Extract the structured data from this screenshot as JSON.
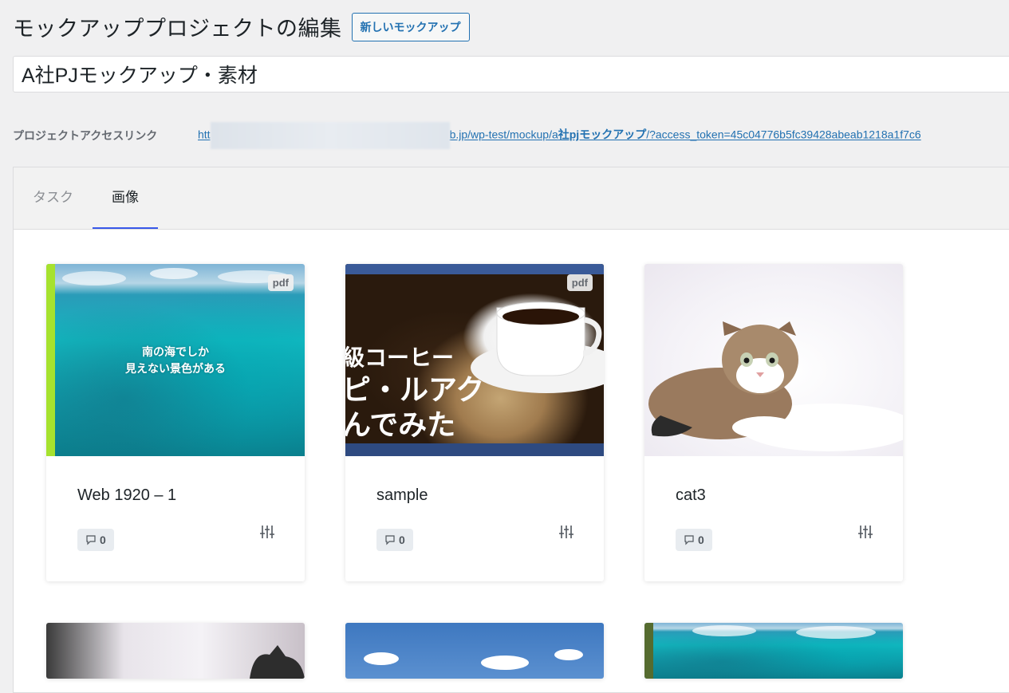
{
  "header": {
    "title": "モックアッププロジェクトの編集",
    "new_button": "新しいモックアップ"
  },
  "project": {
    "name": "A社PJモックアップ・素材"
  },
  "access": {
    "label": "プロジェクトアクセスリンク",
    "link_prefix": "htt",
    "link_suffix_start": "b.jp/wp-test/mockup/a",
    "link_bold": "社pjモックアップ",
    "link_suffix_end": "/?access_token=45c04776b5fc39428abeab1218a1f7c6"
  },
  "tabs": [
    {
      "label": "タスク",
      "active": false
    },
    {
      "label": "画像",
      "active": true
    }
  ],
  "cards": [
    {
      "title": "Web 1920 – 1",
      "badge": "pdf",
      "comments": "0",
      "overlay_text": [
        "南の海でしか",
        "見えない景色がある"
      ]
    },
    {
      "title": "sample",
      "badge": "pdf",
      "comments": "0",
      "overlay_text": [
        "級コーヒー",
        "ピ・ルアク",
        "んでみた"
      ]
    },
    {
      "title": "cat3",
      "badge": "",
      "comments": "0"
    }
  ],
  "colors": {
    "accent": "#2271b1",
    "tab_indicator": "#3858e9",
    "background": "#f0f0f1"
  }
}
